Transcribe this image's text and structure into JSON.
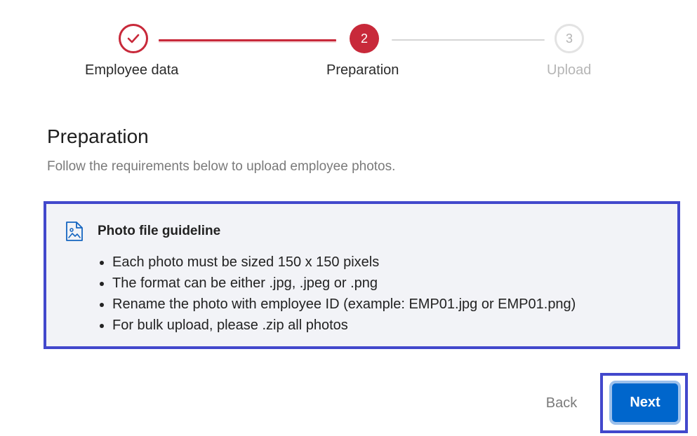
{
  "stepper": {
    "steps": [
      {
        "label": "Employee data",
        "state": "completed",
        "icon": "checkmark-icon"
      },
      {
        "label": "Preparation",
        "number": "2",
        "state": "active"
      },
      {
        "label": "Upload",
        "number": "3",
        "state": "pending"
      }
    ]
  },
  "header": {
    "title": "Preparation",
    "subtitle": "Follow the requirements below to upload employee photos."
  },
  "guideline": {
    "icon": "image-file-icon",
    "title": "Photo file guideline",
    "items": [
      "Each photo must be sized 150 x 150 pixels",
      "The format can be either .jpg, .jpeg or .png",
      "Rename the photo with employee ID (example: EMP01.jpg or EMP01.png)",
      "For bulk upload, please .zip all photos"
    ]
  },
  "actions": {
    "back_label": "Back",
    "next_label": "Next"
  },
  "colors": {
    "accent_red": "#c8293a",
    "primary_blue": "#0066cc",
    "highlight_outline": "#4248cc",
    "card_background": "#f2f3f7"
  }
}
